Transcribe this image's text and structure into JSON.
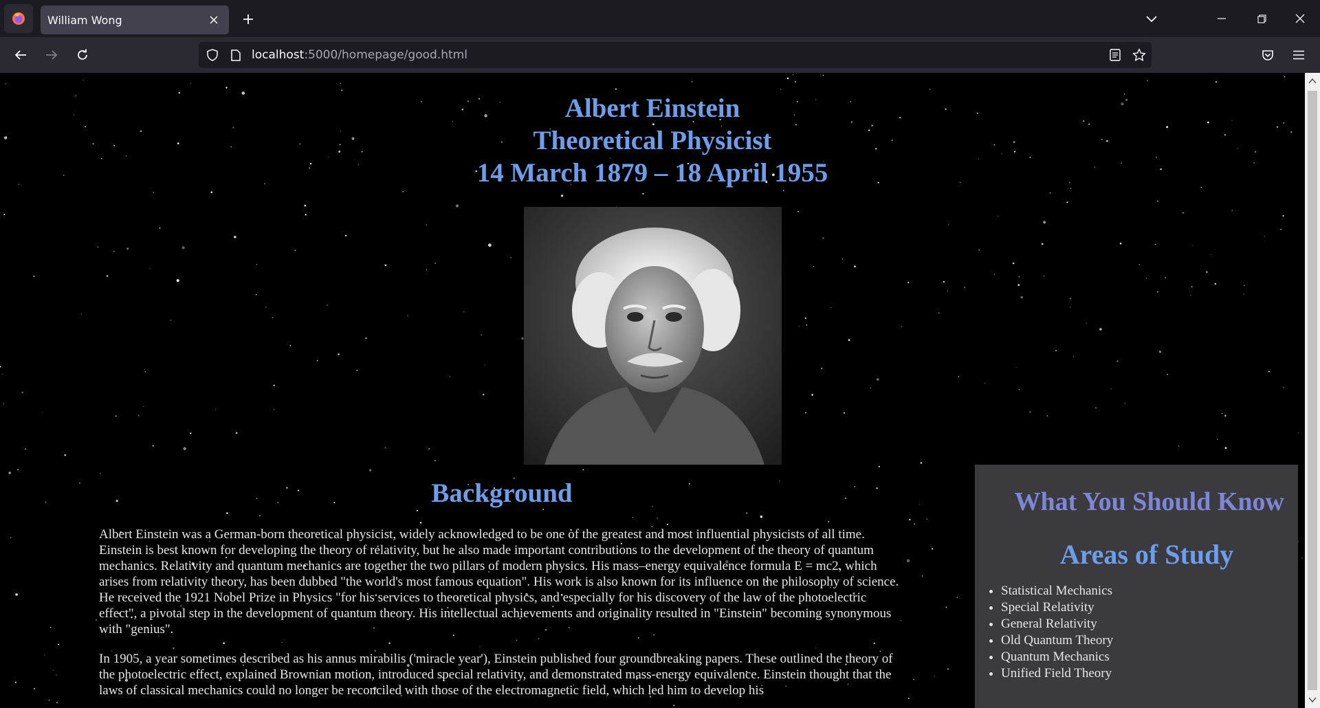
{
  "browser": {
    "tab_title": "William Wong",
    "url_host": "localhost",
    "url_rest": ":5000/homepage/good.html",
    "icons": {
      "logo": "firefox-icon",
      "close_tab": "close-icon",
      "new_tab": "plus-icon",
      "tab_list": "chevron-down-icon",
      "minimize": "minimize-icon",
      "restore": "restore-icon",
      "close_window": "close-icon",
      "back": "arrow-left-icon",
      "forward": "arrow-right-icon",
      "reload": "reload-icon",
      "tracking": "shield-icon",
      "page_info": "page-icon",
      "reader_view": "reader-view-icon",
      "bookmark": "star-icon",
      "pocket": "pocket-icon",
      "menu": "hamburger-icon"
    }
  },
  "page": {
    "header": {
      "name": "Albert Einstein",
      "role": "Theoretical Physicist",
      "dates": "14 March 1879 – 18 April 1955"
    },
    "background": {
      "title": "Background",
      "paragraph1": "Albert Einstein was a German-born theoretical physicist, widely acknowledged to be one of the greatest and most influential physicists of all time. Einstein is best known for developing the theory of relativity, but he also made important contributions to the development of the theory of quantum mechanics. Relativity and quantum mechanics are together the two pillars of modern physics. His mass–energy equivalence formula E = mc2, which arises from relativity theory, has been dubbed \"the world's most famous equation\". His work is also known for its influence on the philosophy of science. He received the 1921 Nobel Prize in Physics \"for his services to theoretical physics, and especially for his discovery of the law of the photoelectric effect\", a pivotal step in the development of quantum theory. His intellectual achievements and originality resulted in \"Einstein\" becoming synonymous with \"genius\".",
      "paragraph2": "In 1905, a year sometimes described as his annus mirabilis ('miracle year'), Einstein published four groundbreaking papers. These outlined the theory of the photoelectric effect, explained Brownian motion, introduced special relativity, and demonstrated mass-energy equivalence. Einstein thought that the laws of classical mechanics could no longer be reconciled with those of the electromagnetic field, which led him to develop his"
    },
    "sidebar": {
      "title": "What You Should Know",
      "subtitle": "Areas of Study",
      "items": [
        "Statistical Mechanics",
        "Special Relativity",
        "General Relativity",
        "Old Quantum Theory",
        "Quantum Mechanics",
        "Unified Field Theory"
      ]
    },
    "colors": {
      "heading": "#6d9eeb",
      "sidebar_title": "#7e86d6",
      "sidebar_bg": "#3a3a3f",
      "background": "#000000"
    }
  }
}
